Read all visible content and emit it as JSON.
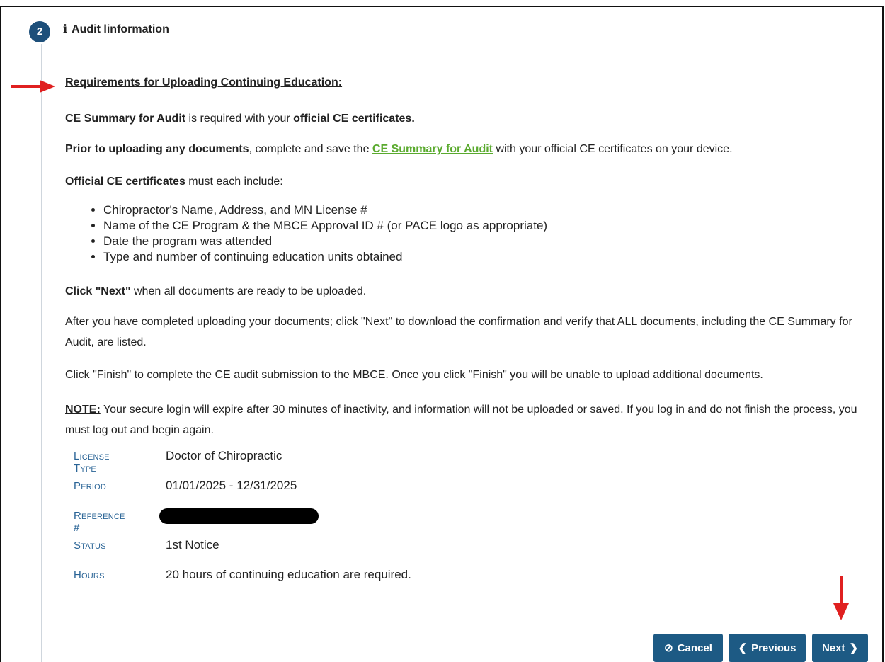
{
  "step": {
    "number": "2",
    "title": "Audit linformation",
    "icon": "info-icon"
  },
  "requirements_heading": "Requirements for Uploading Continuing Education:",
  "summary_para": {
    "bold1": "CE Summary for Audit",
    "text1": " is required with your ",
    "bold2": "official CE certificates."
  },
  "prior_para": {
    "bold": "Prior to uploading any documents",
    "text1": ", complete and save the ",
    "link": "CE Summary for Audit",
    "text2": " with your official CE certificates on your device."
  },
  "official_para": {
    "bold": "Official CE certificates",
    "text": " must each include:"
  },
  "bullets": [
    "Chiropractor's Name, Address, and MN License #",
    "Name of the CE Program & the MBCE Approval ID # (or PACE logo as appropriate)",
    "Date the program was attended",
    "Type and number of continuing education units obtained"
  ],
  "click_next_para": {
    "bold": "Click \"Next\"",
    "text": " when all documents are ready to be uploaded."
  },
  "after_para": "After you have completed uploading your documents; click \"Next\" to download the confirmation and verify that ALL documents, including the CE Summary for Audit, are listed.",
  "finish_para": "Click \"Finish\" to complete the CE audit submission to the MBCE. Once you click \"Finish\" you will be unable to upload additional documents.",
  "note_para": {
    "bold": "NOTE:",
    "text": " Your secure login will expire after 30 minutes of inactivity, and information will not be uploaded or saved. If you log in and do not finish the process, you must log out and begin again."
  },
  "details": {
    "license_type": {
      "label": "License Type",
      "value": "Doctor of Chiropractic"
    },
    "period": {
      "label": "Period",
      "value": "01/01/2025 - 12/31/2025"
    },
    "reference": {
      "label": "Reference #"
    },
    "status": {
      "label": "Status",
      "value": "1st Notice"
    },
    "hours": {
      "label": "Hours",
      "value": "20 hours of continuing education are required."
    }
  },
  "buttons": {
    "cancel": "Cancel",
    "previous": "Previous",
    "next": "Next"
  },
  "colors": {
    "primary": "#1d5a84",
    "link": "#5aaa2e",
    "label": "#2a6496",
    "annotation_arrow": "#e02020"
  }
}
